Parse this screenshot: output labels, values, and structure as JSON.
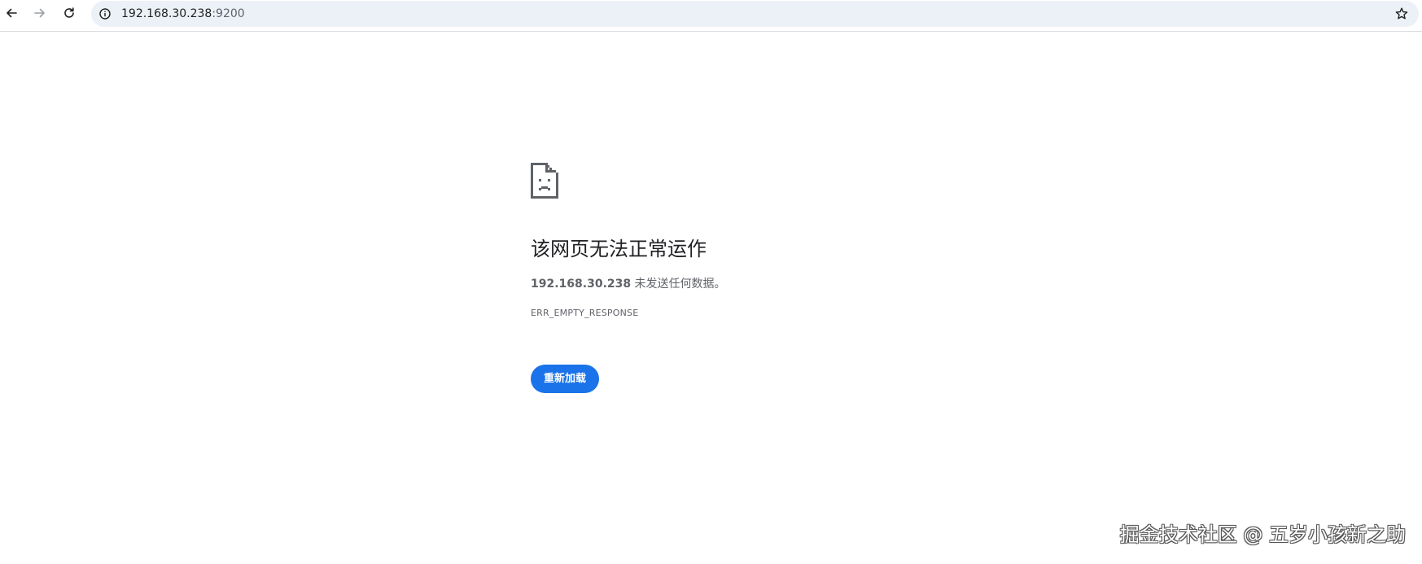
{
  "browser": {
    "url_host": "192.168.30.238",
    "url_port": ":9200",
    "icons": {
      "back": "back-arrow-icon",
      "forward": "forward-arrow-icon",
      "reload": "reload-icon",
      "site_info": "info-icon",
      "bookmark": "star-icon"
    }
  },
  "error_page": {
    "title": "该网页无法正常运作",
    "host": "192.168.30.238",
    "message_suffix": " 未发送任何数据。",
    "error_code": "ERR_EMPTY_RESPONSE",
    "reload_label": "重新加载",
    "icon": "sad-page-icon"
  },
  "watermark": {
    "text": "掘金技术社区 @ 五岁小孩新之助"
  },
  "colors": {
    "accent": "#1a73e8",
    "omnibox_bg": "#ecf1f7",
    "text_primary": "#202124",
    "text_secondary": "#5f6368"
  }
}
